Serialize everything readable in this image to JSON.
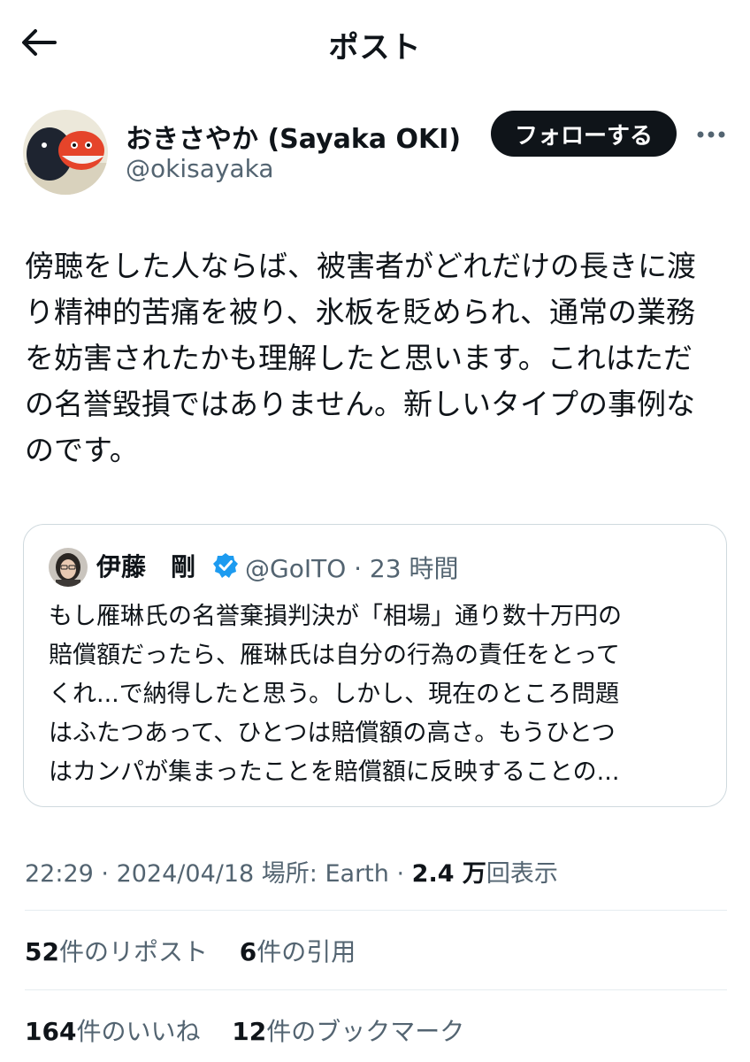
{
  "header": {
    "title": "ポスト"
  },
  "author": {
    "name": "おきさやか (Sayaka OKI)",
    "handle": "@okisayaka",
    "follow_label": "フォローする"
  },
  "post": {
    "lines": [
      "傍聴をした人ならば、被害者がどれだけの長きに渡",
      "り精神的苦痛を被り、氷板を貶められ、通常の業務",
      "を妨害されたかも理解したと思います。これはただ",
      "の名誉毀損ではありません。新しいタイプの事例な",
      "のです。"
    ]
  },
  "quote": {
    "name": "伊藤　剛",
    "handle_time": "@GoITO · 23 時間",
    "lines": [
      "もし雁琳氏の名誉棄損判決が「相場」通り数十万円の",
      "賠償額だったら、雁琳氏は自分の行為の責任をとって",
      "くれ...で納得したと思う。しかし、現在のところ問題",
      "はふたつあって、ひとつは賠償額の高さ。もうひとつ",
      "はカンパが集まったことを賠償額に反映することの..."
    ]
  },
  "meta": {
    "time": "22:29",
    "date": "2024/04/18",
    "location": "場所: Earth",
    "views_num": "2.4 万",
    "views_label": "回表示"
  },
  "stats": {
    "reposts_num": "52",
    "reposts_label": "件のリポスト",
    "quotes_num": "6",
    "quotes_label": "件の引用",
    "likes_num": "164",
    "likes_label": "件のいいね",
    "bookmarks_num": "12",
    "bookmarks_label": "件のブックマーク"
  },
  "colors": {
    "text": "#0f1419",
    "secondary": "#536471",
    "verified": "#1d9bf0",
    "border": "#cfd9de"
  }
}
